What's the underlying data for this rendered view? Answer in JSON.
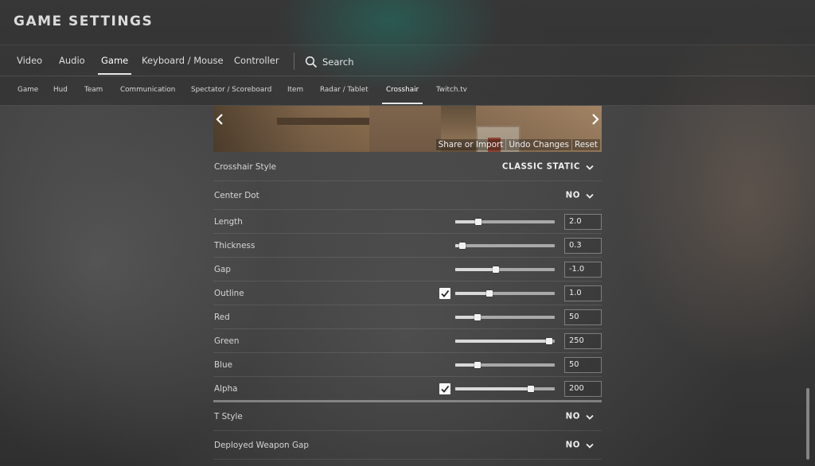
{
  "app": {
    "title": "GAME SETTINGS"
  },
  "main_tabs": [
    {
      "label": "Video"
    },
    {
      "label": "Audio"
    },
    {
      "label": "Game",
      "active": true
    },
    {
      "label": "Keyboard / Mouse"
    },
    {
      "label": "Controller"
    }
  ],
  "search": {
    "label": "Search",
    "icon": "search-icon"
  },
  "sub_tabs": [
    {
      "label": "Game"
    },
    {
      "label": "Hud"
    },
    {
      "label": "Team"
    },
    {
      "label": "Communication"
    },
    {
      "label": "Spectator / Scoreboard"
    },
    {
      "label": "Item"
    },
    {
      "label": "Radar / Tablet"
    },
    {
      "label": "Crosshair",
      "active": true
    },
    {
      "label": "Twitch.tv"
    }
  ],
  "preview": {
    "prev_icon": "chevron-left-icon",
    "next_icon": "chevron-right-icon",
    "actions": [
      "Share or Import",
      "Undo Changes",
      "Reset"
    ]
  },
  "settings": {
    "crosshair_style": {
      "label": "Crosshair Style",
      "value": "CLASSIC STATIC"
    },
    "center_dot": {
      "label": "Center Dot",
      "value": "NO"
    },
    "length": {
      "label": "Length",
      "value": "2.0",
      "fraction": 0.23
    },
    "thickness": {
      "label": "Thickness",
      "value": "0.3",
      "fraction": 0.07
    },
    "gap": {
      "label": "Gap",
      "value": "-1.0",
      "fraction": 0.41
    },
    "outline": {
      "label": "Outline",
      "value": "1.0",
      "fraction": 0.34,
      "checked": true
    },
    "red": {
      "label": "Red",
      "value": "50",
      "fraction": 0.22
    },
    "green": {
      "label": "Green",
      "value": "250",
      "fraction": 0.94
    },
    "blue": {
      "label": "Blue",
      "value": "50",
      "fraction": 0.22
    },
    "alpha": {
      "label": "Alpha",
      "value": "200",
      "fraction": 0.76,
      "checked": true
    },
    "t_style": {
      "label": "T Style",
      "value": "NO"
    },
    "deployed_weapon_gap": {
      "label": "Deployed Weapon Gap",
      "value": "NO"
    }
  },
  "colors": {
    "accent": "#e8e8e8",
    "slider_track": "#a9a9a9",
    "checkbox": "#fafafa"
  }
}
